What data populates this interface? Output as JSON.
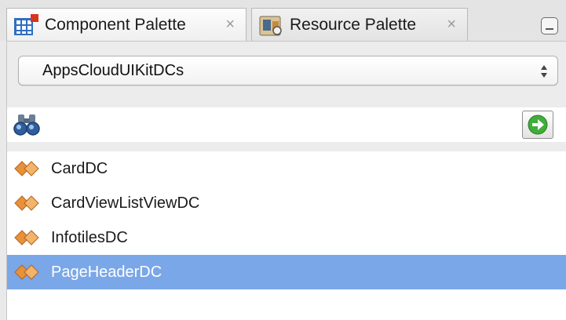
{
  "tabs": [
    {
      "label": "Component Palette",
      "close": "×",
      "icon": "component-palette-icon"
    },
    {
      "label": "Resource Palette",
      "close": "×",
      "icon": "resource-palette-icon"
    }
  ],
  "library_select": {
    "value": "AppsCloudUIKitDCs"
  },
  "search": {
    "value": "",
    "placeholder": ""
  },
  "components": [
    {
      "label": "CardDC",
      "icon": "component-diamond-icon"
    },
    {
      "label": "CardViewListViewDC",
      "icon": "component-diamond-icon"
    },
    {
      "label": "InfotilesDC",
      "icon": "component-diamond-icon"
    },
    {
      "label": "PageHeaderDC",
      "icon": "component-diamond-icon",
      "selected": true
    }
  ],
  "colors": {
    "selection": "#7aa7e8",
    "go_button": "#3fae3a",
    "item_icon": "#e8913a"
  }
}
